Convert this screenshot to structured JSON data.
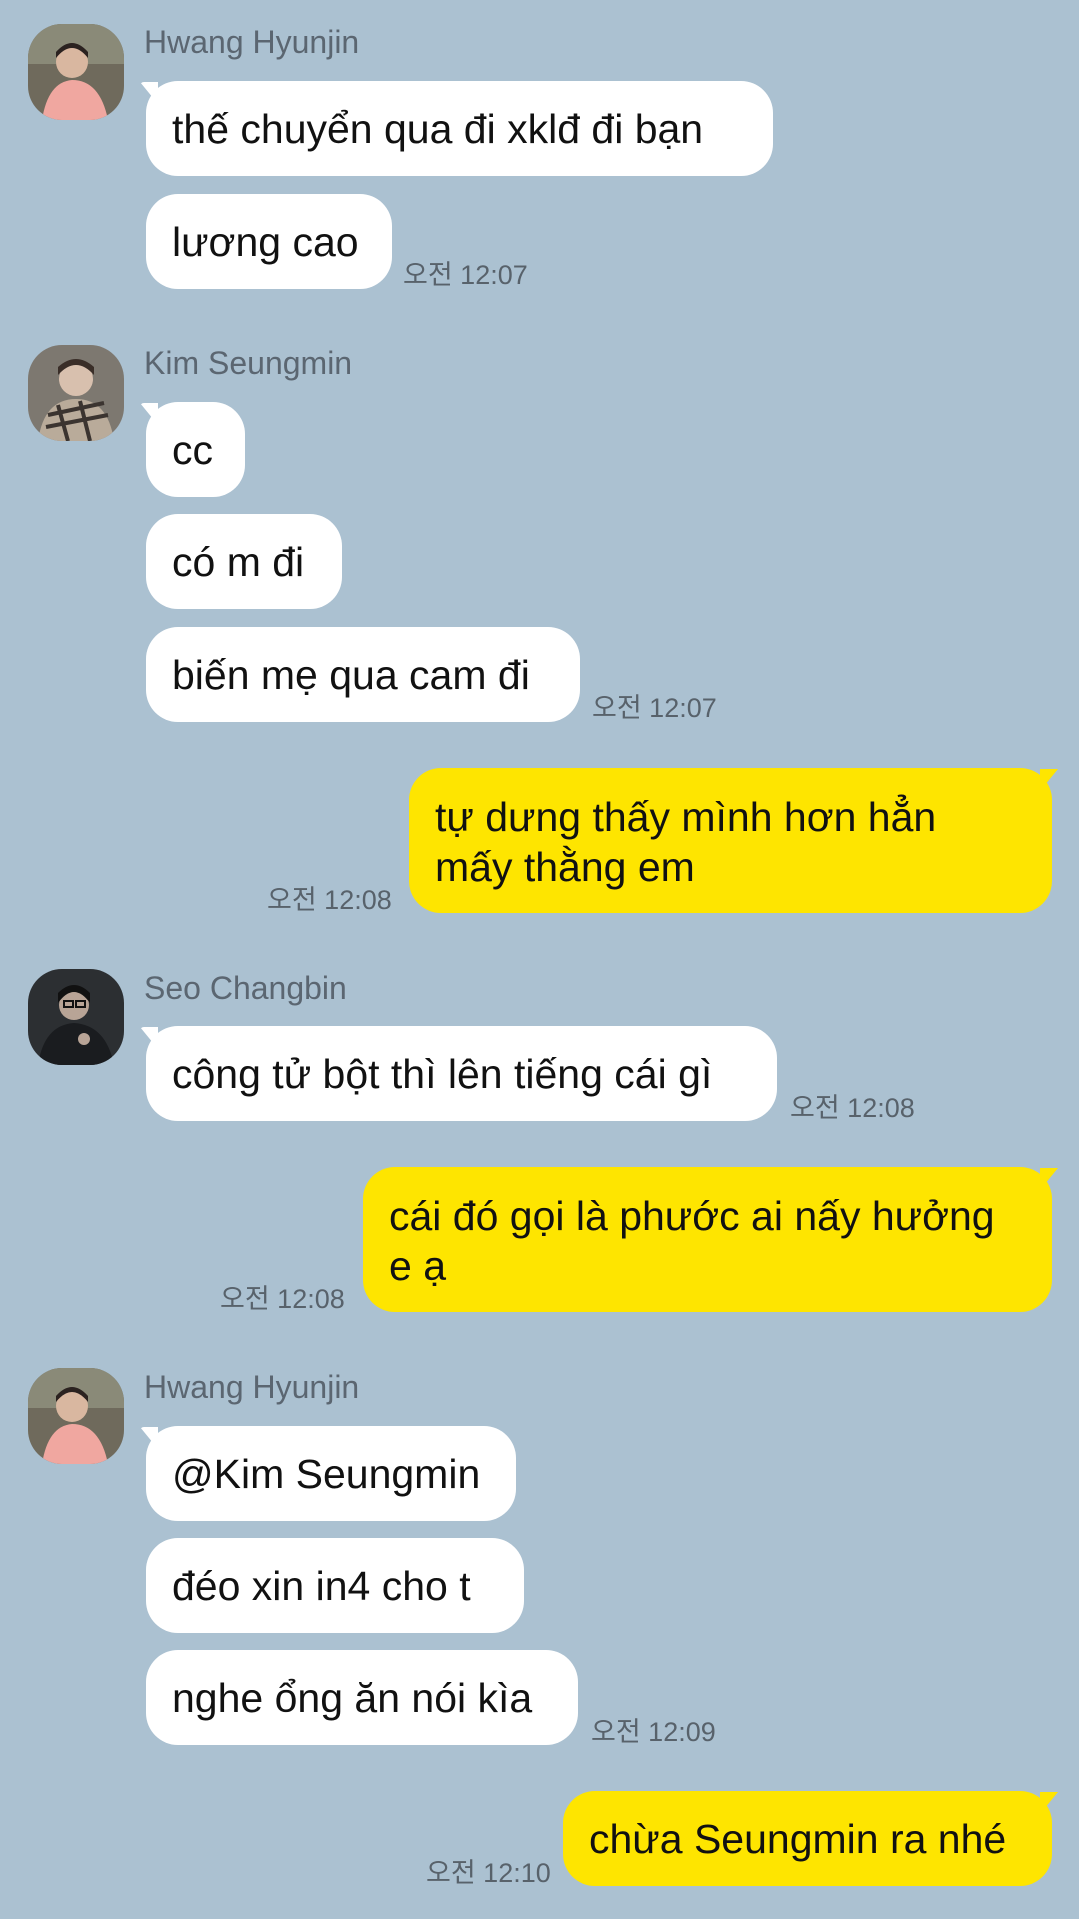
{
  "colors": {
    "background": "#abc1d1",
    "incoming_bubble": "#ffffff",
    "outgoing_bubble": "#fee500",
    "name_text": "#5b6671",
    "time_text": "#58626b"
  },
  "chat": {
    "group1": {
      "sender": "Hwang Hyunjin",
      "avatar_icon": "profile-photo-icon",
      "messages": [
        "thế chuyển qua đi xklđ đi bạn",
        "lương cao"
      ],
      "time": "오전 12:07"
    },
    "group2": {
      "sender": "Kim Seungmin",
      "avatar_icon": "profile-photo-icon",
      "messages": [
        "cc",
        "có m đi",
        "biến mẹ qua cam đi"
      ],
      "time": "오전 12:07"
    },
    "out1": {
      "lines": [
        "tự dưng thấy mình hơn hẳn",
        "mấy thằng em"
      ],
      "time": "오전 12:08"
    },
    "group3": {
      "sender": "Seo Changbin",
      "avatar_icon": "profile-photo-icon",
      "messages": [
        "công tử bột thì lên tiếng cái gì"
      ],
      "time": "오전 12:08"
    },
    "out2": {
      "lines": [
        "cái đó gọi là phước ai nấy hưởng",
        "e ạ"
      ],
      "time": "오전 12:08"
    },
    "group4": {
      "sender": "Hwang Hyunjin",
      "avatar_icon": "profile-photo-icon",
      "messages": [
        "@Kim Seungmin",
        "đéo xin in4 cho t",
        "nghe ổng ăn nói kìa"
      ],
      "time": "오전 12:09"
    },
    "out3": {
      "lines": [
        "chừa Seungmin ra nhé"
      ],
      "time": "오전 12:10"
    }
  }
}
